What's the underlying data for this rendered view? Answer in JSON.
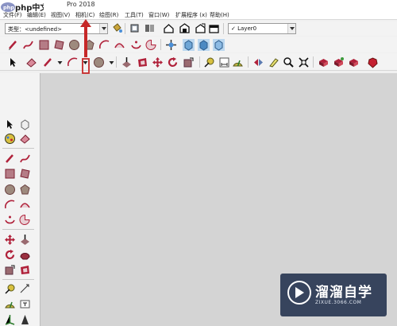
{
  "window": {
    "title": "Pro 2018"
  },
  "watermark_logo": {
    "text": "php中文网"
  },
  "menu": [
    {
      "label": "文件(F)"
    },
    {
      "label": "编辑(E)"
    },
    {
      "label": "视图(V)"
    },
    {
      "label": "相机(C)"
    },
    {
      "label": "绘图(R)"
    },
    {
      "label": "工具(T)"
    },
    {
      "label": "窗口(W)"
    },
    {
      "label": "扩展程序 (x)"
    },
    {
      "label": "帮助(H)"
    }
  ],
  "material_combo": {
    "label": "类型：<undefined>"
  },
  "layer_combo": {
    "check": "✓",
    "label": "Layer0"
  },
  "watermark": {
    "title": "溜溜自学",
    "subtitle": "ZIXUE.3066.COM"
  },
  "colors": {
    "accent": "#b0213a",
    "viewport": "#d4d4d4",
    "annotation": "#c62828"
  }
}
